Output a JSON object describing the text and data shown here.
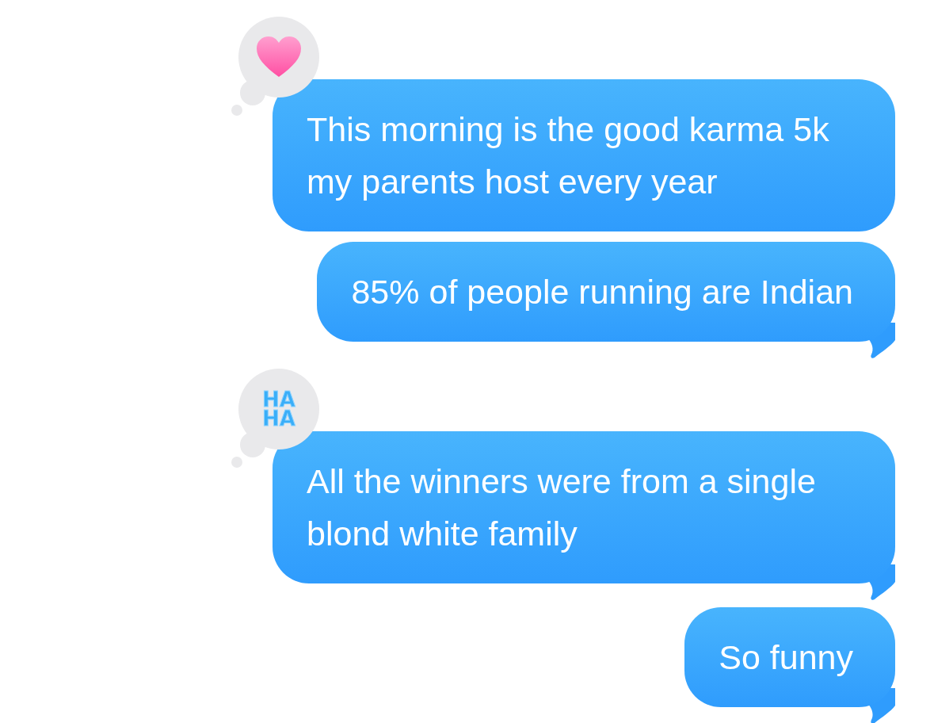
{
  "messages": [
    {
      "text": "This morning is the good karma 5k my parents host every year",
      "tail": false,
      "reaction": {
        "kind": "heart"
      }
    },
    {
      "text": "85% of people running are Indian",
      "tail": true
    },
    {
      "text": "All the winners were from a single blond white family",
      "tail": true,
      "reaction": {
        "kind": "haha",
        "lines": [
          "HA",
          "HA"
        ]
      }
    },
    {
      "text": "So funny",
      "tail": true
    }
  ]
}
